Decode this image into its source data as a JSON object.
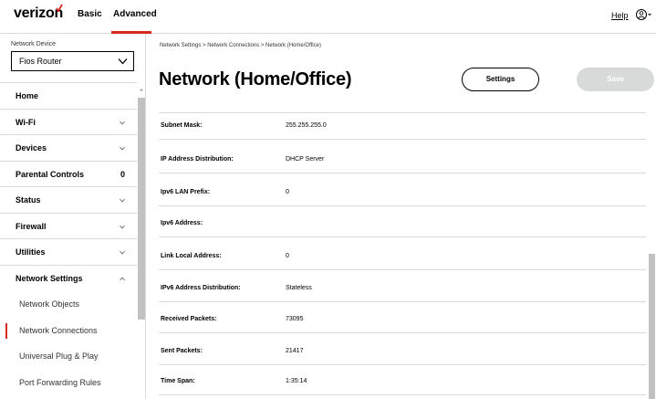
{
  "header": {
    "logo_text": "verizon",
    "nav": {
      "basic": "Basic",
      "advanced": "Advanced"
    },
    "help": "Help",
    "brand_color": "#d52b1e"
  },
  "sidebar": {
    "device_label": "Network Device",
    "device_value": "Fios Router",
    "items": [
      {
        "label": "Home",
        "type": "top"
      },
      {
        "label": "Wi-Fi",
        "type": "top",
        "expandable": true
      },
      {
        "label": "Devices",
        "type": "top",
        "expandable": true
      },
      {
        "label": "Parental Controls",
        "type": "top",
        "count": "0"
      },
      {
        "label": "Status",
        "type": "top",
        "expandable": true
      },
      {
        "label": "Firewall",
        "type": "top",
        "expandable": true
      },
      {
        "label": "Utilities",
        "type": "top",
        "expandable": true
      },
      {
        "label": "Network Settings",
        "type": "top",
        "expanded": true
      },
      {
        "label": "Network Objects",
        "type": "sub"
      },
      {
        "label": "Network Connections",
        "type": "sub",
        "active": true
      },
      {
        "label": "Universal Plug & Play",
        "type": "sub"
      },
      {
        "label": "Port Forwarding Rules",
        "type": "sub"
      }
    ]
  },
  "main": {
    "breadcrumb": "Network Settings  >  Network Connections  >  Network (Home/Office)",
    "title": "Network (Home/Office)",
    "settings_label": "Settings",
    "save_label": "Save",
    "rows": [
      {
        "label": "Subnet Mask:",
        "value": "255.255.255.0"
      },
      {
        "label": "IP Address Distribution:",
        "value": "DHCP Server"
      },
      {
        "label": "Ipv6 LAN Prefix:",
        "value": "0"
      },
      {
        "label": "Ipv6 Address:",
        "value": ""
      },
      {
        "label": "Link Local Address:",
        "value": "0"
      },
      {
        "label": "IPv6 Address Distribution:",
        "value": "Stateless"
      },
      {
        "label": "Received Packets:",
        "value": "73095"
      },
      {
        "label": "Sent Packets:",
        "value": "21417"
      },
      {
        "label": "Time Span:",
        "value": "1:35:14"
      }
    ]
  }
}
